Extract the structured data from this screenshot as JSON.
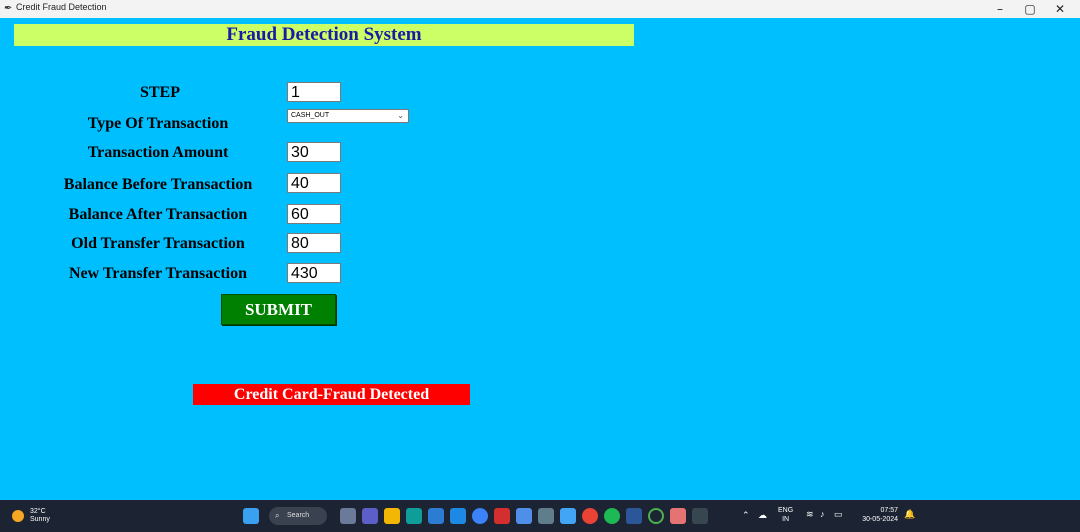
{
  "window": {
    "title": "Credit Fraud Detection",
    "controls": {
      "minimize": "–",
      "maximize": "▢",
      "close": "✕"
    }
  },
  "app": {
    "heading": "Fraud Detection System",
    "colors": {
      "background": "#00BFFF",
      "header_bar": "#CCFF66",
      "heading_text": "#1A1AA6",
      "submit_bg": "#008000",
      "result_bg": "#FF0000"
    }
  },
  "form": {
    "step": {
      "label": "STEP",
      "value": "1"
    },
    "type": {
      "label": "Type Of Transaction",
      "selected": "CASH_OUT"
    },
    "amount": {
      "label": "Transaction Amount",
      "value": "30"
    },
    "balance_before": {
      "label": "Balance Before Transaction",
      "value": "40"
    },
    "balance_after": {
      "label": "Balance After Transaction",
      "value": "60"
    },
    "old_transfer": {
      "label": "Old Transfer Transaction",
      "value": "80"
    },
    "new_transfer": {
      "label": "New Transfer Transaction",
      "value": "430"
    },
    "submit_label": "SUBMIT"
  },
  "result": {
    "text": "Credit Card-Fraud Detected"
  },
  "taskbar": {
    "weather_temp": "32°C",
    "weather_desc": "Sunny",
    "search_label": "Search",
    "lang_1": "ENG",
    "lang_2": "IN",
    "time": "07:57",
    "date": "30-05-2024"
  }
}
